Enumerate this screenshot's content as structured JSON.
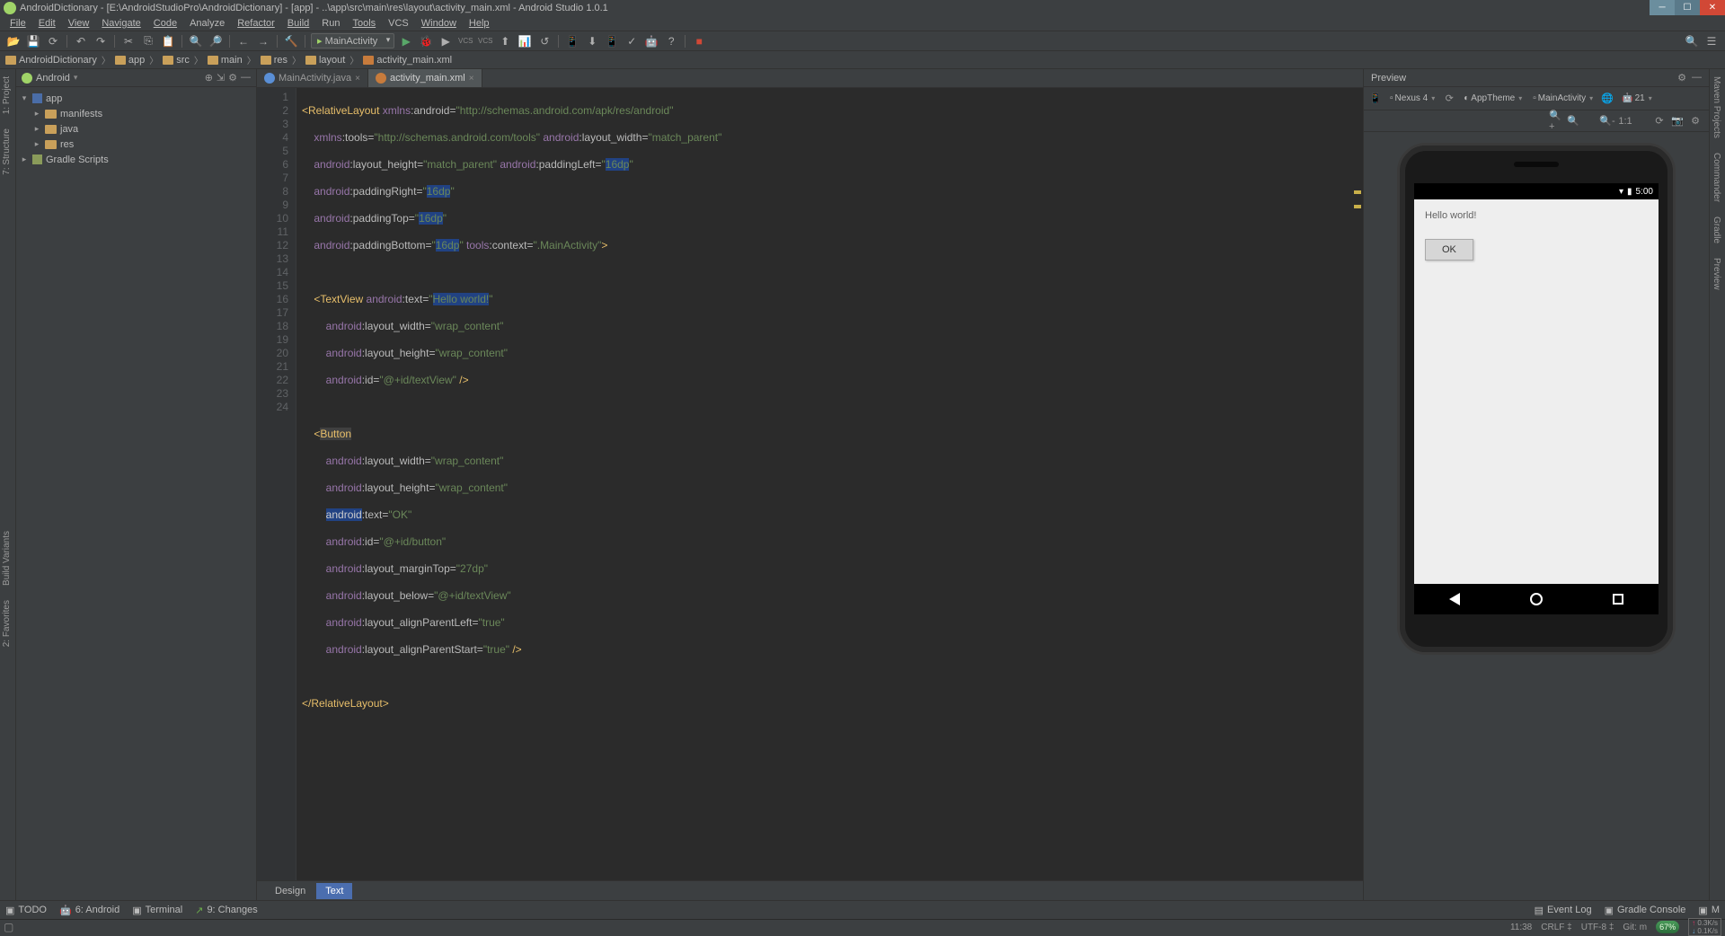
{
  "window": {
    "title": "AndroidDictionary - [E:\\AndroidStudioPro\\AndroidDictionary] - [app] - ..\\app\\src\\main\\res\\layout\\activity_main.xml - Android Studio 1.0.1"
  },
  "menu": [
    "File",
    "Edit",
    "View",
    "Navigate",
    "Code",
    "Analyze",
    "Refactor",
    "Build",
    "Run",
    "Tools",
    "VCS",
    "Window",
    "Help"
  ],
  "toolbar": {
    "run_config": "MainActivity"
  },
  "breadcrumb": [
    "AndroidDictionary",
    "app",
    "src",
    "main",
    "res",
    "layout",
    "activity_main.xml"
  ],
  "left_rail": [
    "1: Project",
    "7: Structure",
    "2: Favorites",
    "Build Variants"
  ],
  "right_rail": [
    "Maven Projects",
    "Commander",
    "Gradle",
    "Preview"
  ],
  "project": {
    "view_mode": "Android",
    "tree": {
      "app": "app",
      "manifests": "manifests",
      "java": "java",
      "res": "res",
      "gradle": "Gradle Scripts"
    }
  },
  "tabs": [
    {
      "label": "MainActivity.java",
      "icon": "java",
      "active": false
    },
    {
      "label": "activity_main.xml",
      "icon": "xml",
      "active": true
    }
  ],
  "code_lines": 24,
  "code": {
    "l1": {
      "tag": "RelativeLayout",
      "p1": "xmlns",
      "a1": "android",
      "v1": "\"http://schemas.android.com/apk/res/android\""
    },
    "l2": {
      "p1": "xmlns",
      "a1": "tools",
      "v1": "\"http://schemas.android.com/tools\"",
      "p2": "android",
      "a2": "layout_width",
      "v2": "\"match_parent\""
    },
    "l3": {
      "p1": "android",
      "a1": "layout_height",
      "v1": "\"match_parent\"",
      "p2": "android",
      "a2": "paddingLeft",
      "v2a": "\"",
      "v2b": "16dp",
      "v2c": "\""
    },
    "l4": {
      "p1": "android",
      "a1": "paddingRight",
      "v1a": "\"",
      "v1b": "16dp",
      "v1c": "\""
    },
    "l5": {
      "p1": "android",
      "a1": "paddingTop",
      "v1a": "\"",
      "v1b": "16dp",
      "v1c": "\""
    },
    "l6": {
      "p1": "android",
      "a1": "paddingBottom",
      "v1a": "\"",
      "v1b": "16dp",
      "v1c": "\"",
      "p2": "tools",
      "a2": "context",
      "v2": "\".MainActivity\"",
      "end": ">"
    },
    "l8": {
      "tag": "TextView",
      "p1": "android",
      "a1": "text",
      "v1a": "\"",
      "v1b": "Hello world!",
      "v1c": "\""
    },
    "l9": {
      "p1": "android",
      "a1": "layout_width",
      "v1": "\"wrap_content\""
    },
    "l10": {
      "p1": "android",
      "a1": "layout_height",
      "v1": "\"wrap_content\""
    },
    "l11": {
      "p1": "android",
      "a1": "id",
      "v1": "\"@+id/textView\"",
      "end": " />"
    },
    "l13": {
      "tag": "Button"
    },
    "l14": {
      "p1": "android",
      "a1": "layout_width",
      "v1": "\"wrap_content\""
    },
    "l15": {
      "p1": "android",
      "a1": "layout_height",
      "v1": "\"wrap_content\""
    },
    "l16": {
      "p1h": "android",
      "a1": "text",
      "v1": "\"OK\""
    },
    "l17": {
      "p1": "android",
      "a1": "id",
      "v1": "\"@+id/button\""
    },
    "l18": {
      "p1": "android",
      "a1": "layout_marginTop",
      "v1": "\"27dp\""
    },
    "l19": {
      "p1": "android",
      "a1": "layout_below",
      "v1": "\"@+id/textView\""
    },
    "l20": {
      "p1": "android",
      "a1": "layout_alignParentLeft",
      "v1": "\"true\""
    },
    "l21": {
      "p1": "android",
      "a1": "layout_alignParentStart",
      "v1": "\"true\"",
      "end": " />"
    },
    "l23": {
      "close": "RelativeLayout"
    }
  },
  "editor_footer": {
    "design": "Design",
    "text": "Text"
  },
  "preview": {
    "title": "Preview",
    "device": "Nexus 4",
    "theme": "AppTheme",
    "activity": "MainActivity",
    "api": "21",
    "status_time": "5:00",
    "hello": "Hello world!",
    "ok": "OK"
  },
  "status": {
    "todo": "TODO",
    "android": "6: Android",
    "terminal": "Terminal",
    "changes": "9: Changes",
    "eventlog": "Event Log",
    "gradle_console": "Gradle Console",
    "memory_right": "M"
  },
  "bottom": {
    "pos": "11:38",
    "crlf": "CRLF",
    "enc": "UTF-8",
    "git": "Git: m",
    "mem": "67%",
    "net_up": "0.3K/s",
    "net_dn": "0.1K/s"
  }
}
